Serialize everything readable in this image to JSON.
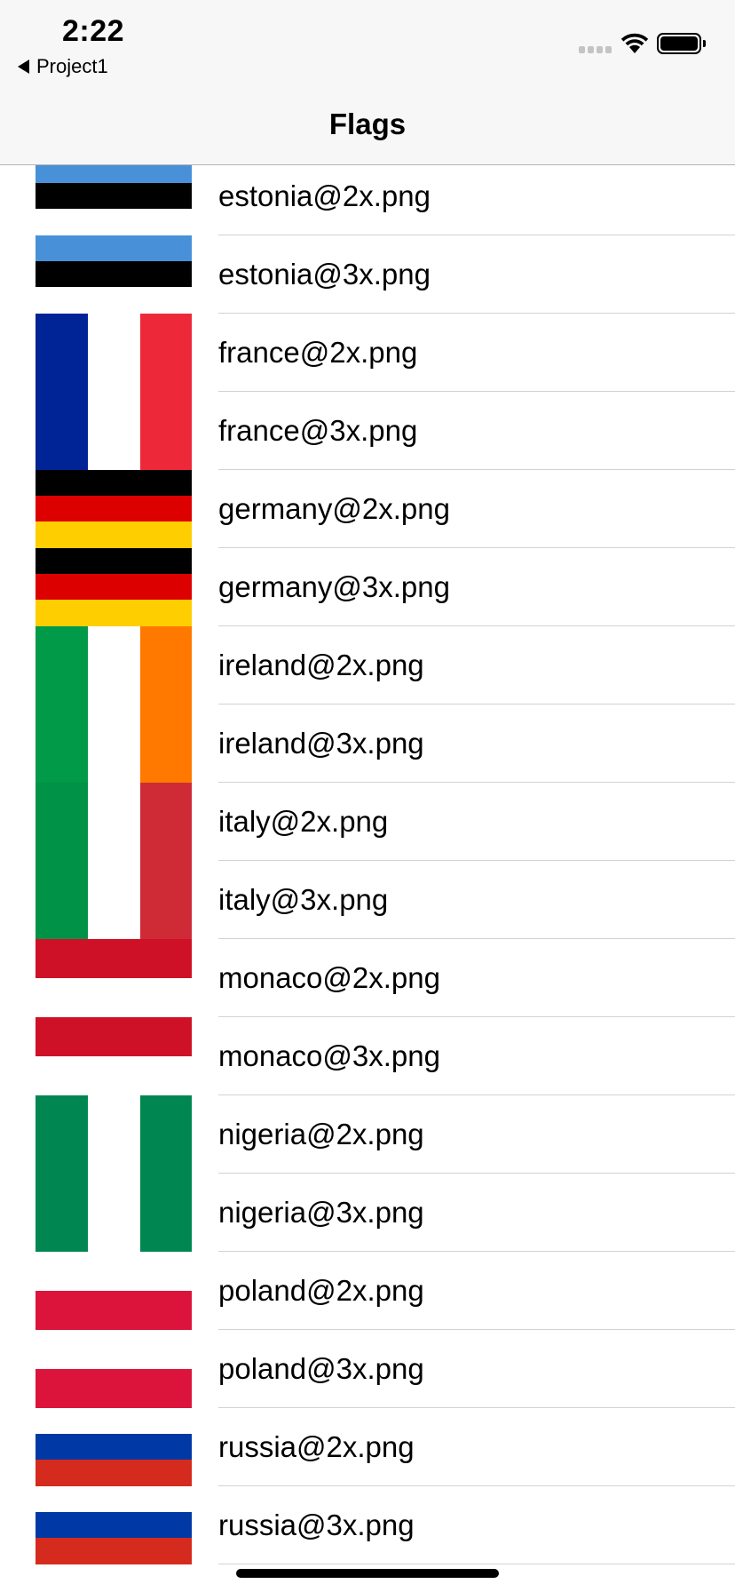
{
  "status_bar": {
    "time": "2:22",
    "back_label": "Project1"
  },
  "nav": {
    "title": "Flags"
  },
  "rows": [
    {
      "label": "estonia@2x.png",
      "flag": "estonia"
    },
    {
      "label": "estonia@3x.png",
      "flag": "estonia"
    },
    {
      "label": "france@2x.png",
      "flag": "france"
    },
    {
      "label": "france@3x.png",
      "flag": "france"
    },
    {
      "label": "germany@2x.png",
      "flag": "germany"
    },
    {
      "label": "germany@3x.png",
      "flag": "germany"
    },
    {
      "label": "ireland@2x.png",
      "flag": "ireland"
    },
    {
      "label": "ireland@3x.png",
      "flag": "ireland"
    },
    {
      "label": "italy@2x.png",
      "flag": "italy"
    },
    {
      "label": "italy@3x.png",
      "flag": "italy"
    },
    {
      "label": "monaco@2x.png",
      "flag": "monaco"
    },
    {
      "label": "monaco@3x.png",
      "flag": "monaco"
    },
    {
      "label": "nigeria@2x.png",
      "flag": "nigeria"
    },
    {
      "label": "nigeria@3x.png",
      "flag": "nigeria"
    },
    {
      "label": "poland@2x.png",
      "flag": "poland"
    },
    {
      "label": "poland@3x.png",
      "flag": "poland"
    },
    {
      "label": "russia@2x.png",
      "flag": "russia"
    },
    {
      "label": "russia@3x.png",
      "flag": "russia"
    }
  ],
  "colors": {
    "estonia": [
      "#4891d9",
      "#000000",
      "#ffffff"
    ],
    "france": [
      "#002395",
      "#ffffff",
      "#ed2939"
    ],
    "germany": [
      "#000000",
      "#dd0000",
      "#ffce00"
    ],
    "ireland": [
      "#009a49",
      "#ffffff",
      "#ff7900"
    ],
    "italy": [
      "#009246",
      "#ffffff",
      "#ce2b37"
    ],
    "monaco": [
      "#ce1126",
      "#ffffff"
    ],
    "nigeria": [
      "#008751",
      "#ffffff",
      "#008751"
    ],
    "poland": [
      "#ffffff",
      "#dc143c"
    ],
    "russia": [
      "#ffffff",
      "#0039a6",
      "#d52b1e"
    ]
  }
}
